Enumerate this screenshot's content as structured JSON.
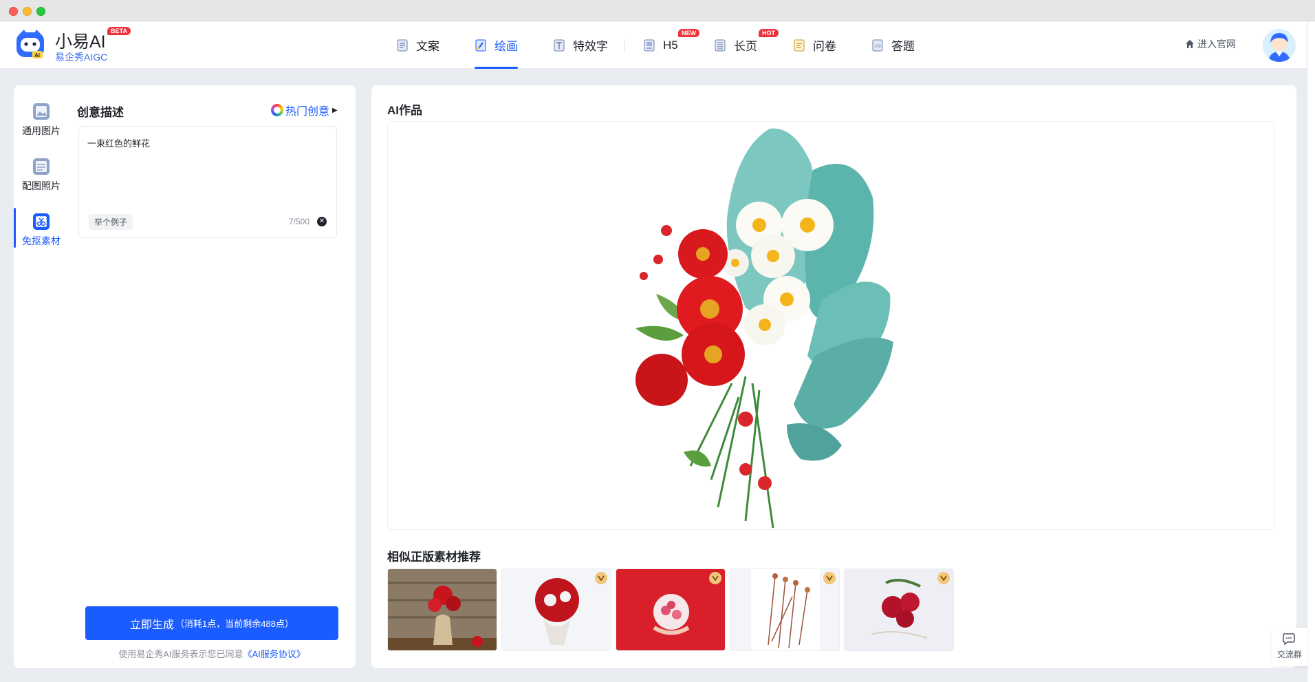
{
  "window": {
    "controls": [
      "close",
      "minimize",
      "zoom"
    ]
  },
  "brand": {
    "name": "小易AI",
    "badge": "BETA",
    "subtitle": "易企秀AIGC"
  },
  "nav": {
    "items": [
      {
        "label": "文案",
        "icon": "doc-icon",
        "active": false
      },
      {
        "label": "绘画",
        "icon": "paint-icon",
        "active": true
      },
      {
        "label": "特效字",
        "icon": "text-effect-icon",
        "active": false
      },
      {
        "label": "H5",
        "icon": "h5-icon",
        "active": false,
        "badge": "NEW"
      },
      {
        "label": "长页",
        "icon": "long-page-icon",
        "active": false,
        "badge": "HOT"
      },
      {
        "label": "问卷",
        "icon": "survey-icon",
        "active": false
      },
      {
        "label": "答题",
        "icon": "quiz-icon",
        "active": false
      }
    ],
    "official_link": "进入官网"
  },
  "sidebar": {
    "items": [
      {
        "label": "通用图片",
        "icon": "image-icon",
        "active": false
      },
      {
        "label": "配图照片",
        "icon": "photo-icon",
        "active": false
      },
      {
        "label": "免抠素材",
        "icon": "cutout-icon",
        "active": true
      }
    ]
  },
  "editor": {
    "title": "创意描述",
    "hot_ideas": "热门创意",
    "prompt_value": "一束红色的鲜花",
    "example_button": "举个例子",
    "counter": "7/500",
    "generate_label": "立即生成",
    "generate_cost": "（消耗1点，当前剩余488点）",
    "agreement_prefix": "使用易企秀AI服务表示您已同意",
    "agreement_link": "《AI服务协议》"
  },
  "result": {
    "title": "AI作品",
    "similar_title": "相似正版素材推荐",
    "thumbnails": [
      {
        "name": "red-flowers-in-burlap-vase",
        "premium": false
      },
      {
        "name": "red-rose-bouquet",
        "premium": true
      },
      {
        "name": "woman-holding-carnation-bouquet",
        "premium": true
      },
      {
        "name": "dried-stems",
        "premium": true
      },
      {
        "name": "red-roses-on-white",
        "premium": true
      }
    ]
  },
  "float": {
    "chat_label": "交流群"
  },
  "colors": {
    "accent": "#1a5cff",
    "badge_red": "#f0323c",
    "premium_gold": "#f3c67a"
  }
}
